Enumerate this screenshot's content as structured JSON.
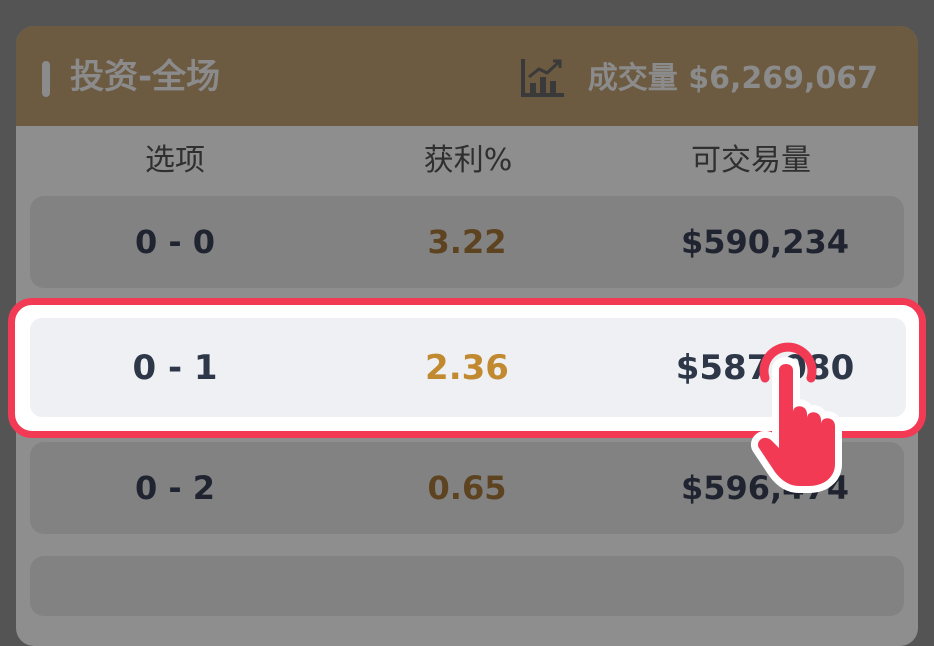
{
  "card": {
    "title": "投资-全场",
    "volume_text": "成交量 $6,269,067"
  },
  "columns": {
    "option": "选项",
    "profit": "获利%",
    "volume": "可交易量"
  },
  "rows": [
    {
      "option": "0 - 0",
      "profit": "3.22",
      "volume": "$590,234"
    },
    {
      "option": "0 - 1",
      "profit": "2.36",
      "volume": "$587,080"
    },
    {
      "option": "0 - 2",
      "profit": "0.65",
      "volume": "$596,474"
    }
  ],
  "colors": {
    "accent": "#f23a55",
    "profit": "#c18a30",
    "header_bg": "#6c5a41"
  },
  "icons": {
    "chart": "chart-icon",
    "tap": "tap-hand-icon"
  }
}
